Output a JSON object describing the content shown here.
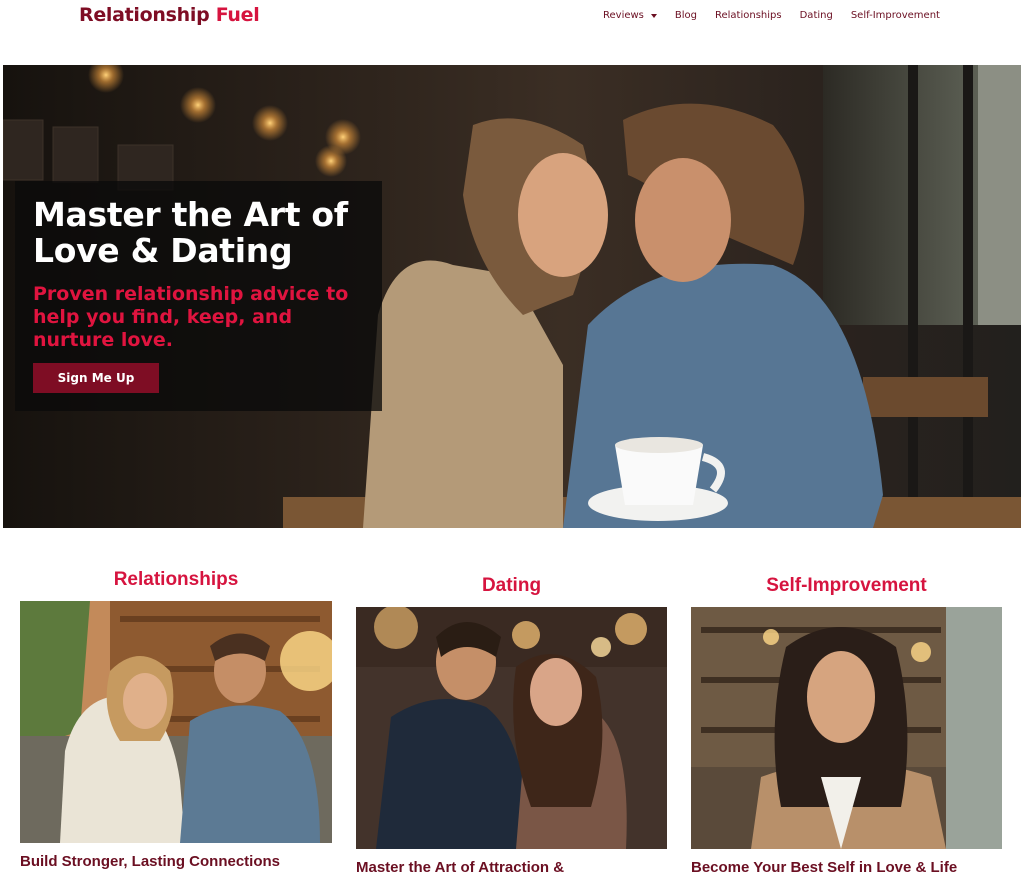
{
  "site": {
    "logo_part1": "Relationship",
    "logo_part2": "Fuel"
  },
  "nav": {
    "items": [
      {
        "label": "Reviews",
        "has_dropdown": true
      },
      {
        "label": "Blog"
      },
      {
        "label": "Relationships"
      },
      {
        "label": "Dating"
      },
      {
        "label": "Self-Improvement"
      }
    ]
  },
  "hero": {
    "title": "Master the Art of Love & Dating",
    "subtitle": "Proven relationship advice to help you find, keep, and nurture love.",
    "button_label": "Sign Me Up"
  },
  "categories": [
    {
      "title": "Relationships",
      "caption": "Build Stronger, Lasting Connections"
    },
    {
      "title": "Dating",
      "caption": "Master the Art of Attraction &"
    },
    {
      "title": "Self-Improvement",
      "caption": "Become Your Best Self in Love & Life"
    }
  ],
  "colors": {
    "brand_dark": "#7e0d24",
    "brand_accent": "#d6143f",
    "nav_text": "#6b0f22"
  }
}
